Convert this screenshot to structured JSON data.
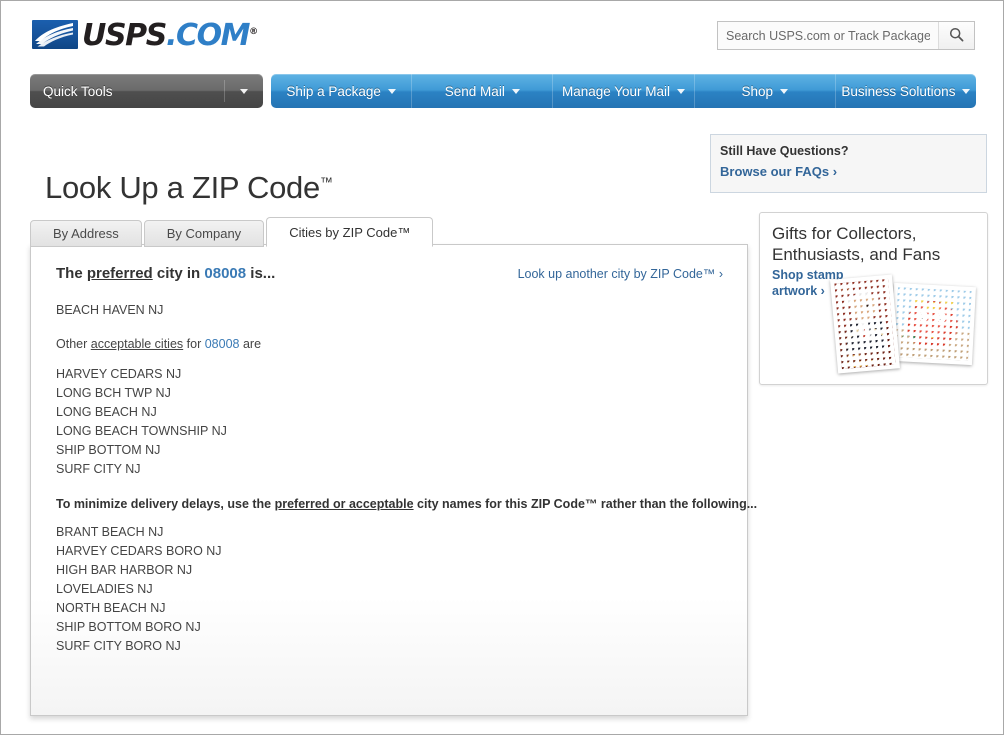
{
  "header": {
    "brand": {
      "usps": "USPS",
      "dotcom": ".COM",
      "trademark": "®",
      "logo_icon": "usps-eagle-logo"
    },
    "search": {
      "placeholder": "Search USPS.com or Track Packages",
      "value": "",
      "icon": "search-icon"
    }
  },
  "nav": {
    "quick_tools": {
      "label": "Quick Tools",
      "caret_icon": "chevron-down-icon"
    },
    "items": [
      {
        "label": "Ship a Package",
        "caret_icon": "chevron-down-icon"
      },
      {
        "label": "Send Mail",
        "caret_icon": "chevron-down-icon"
      },
      {
        "label": "Manage Your Mail",
        "caret_icon": "chevron-down-icon"
      },
      {
        "label": "Shop",
        "caret_icon": "chevron-down-icon"
      },
      {
        "label": "Business Solutions",
        "caret_icon": "chevron-down-icon"
      }
    ]
  },
  "page": {
    "title": "Look Up a ZIP Code",
    "title_tm": "™"
  },
  "faq": {
    "title": "Still Have Questions?",
    "link": "Browse our FAQs ›"
  },
  "tabs": [
    {
      "label": "By Address",
      "active": false
    },
    {
      "label": "By Company",
      "active": false
    },
    {
      "label": "Cities by ZIP Code™",
      "active": true
    }
  ],
  "result": {
    "zip": "08008",
    "heading_pre": "The ",
    "heading_underlined": "preferred",
    "heading_mid": " city in ",
    "heading_post": " is...",
    "lookup_another_link": "Look up another city by ZIP Code™ ›",
    "preferred_city": "BEACH HAVEN NJ",
    "other_pre": "Other ",
    "other_underlined": "acceptable cities",
    "other_mid": " for ",
    "other_post": " are",
    "acceptable_cities": [
      "HARVEY CEDARS NJ",
      "LONG BCH TWP NJ",
      "LONG BEACH NJ",
      "LONG BEACH TOWNSHIP NJ",
      "SHIP BOTTOM NJ",
      "SURF CITY NJ"
    ],
    "minimize_pre": "To minimize delivery delays, use the ",
    "minimize_underlined": "preferred or acceptable",
    "minimize_post": " city names for this ZIP Code™ rather than the following...",
    "not_recommended_cities": [
      "BRANT BEACH NJ",
      "HARVEY CEDARS BORO NJ",
      "HIGH BAR HARBOR NJ",
      "LOVELADIES NJ",
      "NORTH BEACH NJ",
      "SHIP BOTTOM BORO NJ",
      "SURF CITY BORO NJ"
    ]
  },
  "promo": {
    "title": "Gifts for Collectors, Enthusiasts, and Fans",
    "link": "Shop stamp artwork ›",
    "stamp_a_icon": "tito-puente-stamp-image",
    "stamp_b_icon": "lion-dance-stamp-image"
  },
  "colors": {
    "nav_blue": "#3f9ad6",
    "quick_tools_gray": "#5e5e5e",
    "link_blue": "#336699",
    "zip_blue": "#3a7ab5",
    "page_bg": "#ffffff",
    "outer_bg": "#e6e6e6"
  }
}
